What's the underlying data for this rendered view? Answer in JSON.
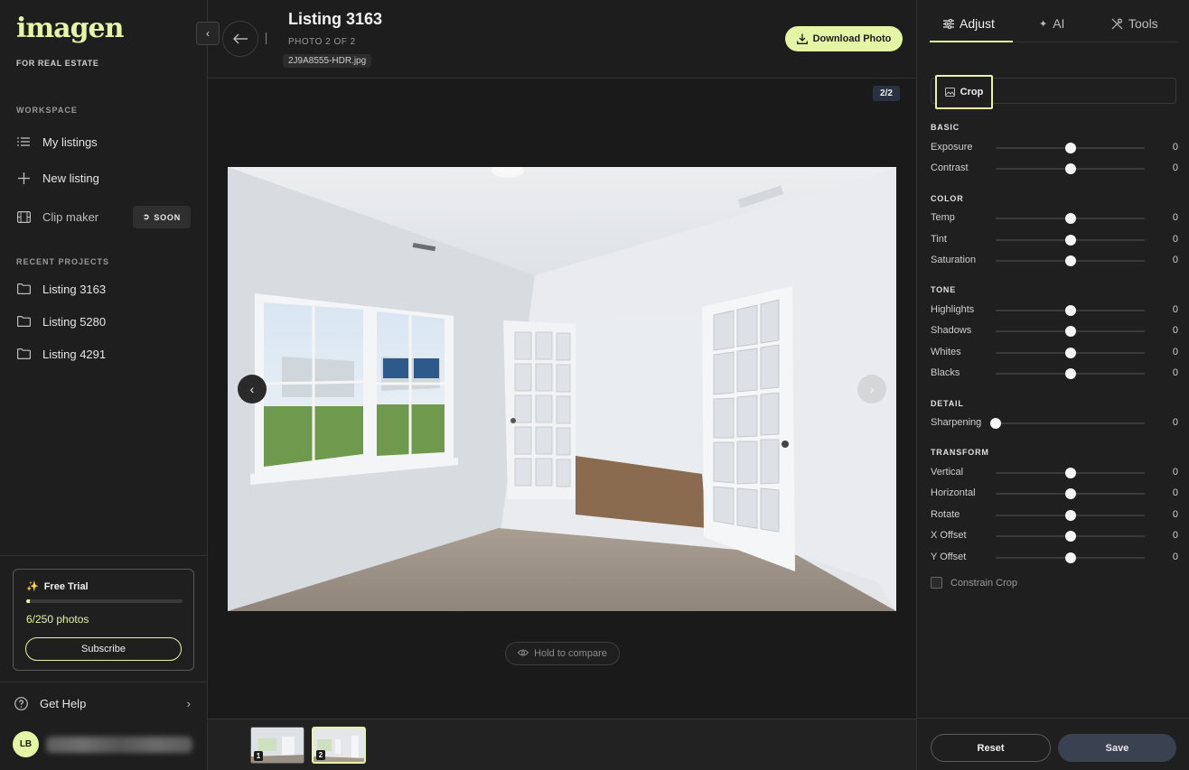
{
  "brand": {
    "logo": "imagen",
    "subtitle": "FOR REAL ESTATE",
    "accent": "#e4f5a6"
  },
  "sidebar": {
    "workspace_label": "WORKSPACE",
    "items": [
      {
        "label": "My listings",
        "icon": "list-icon"
      },
      {
        "label": "New listing",
        "icon": "plus-icon"
      },
      {
        "label": "Clip maker",
        "icon": "film-icon",
        "badge": "SOON"
      }
    ],
    "recent_label": "RECENT PROJECTS",
    "recent": [
      {
        "label": "Listing 3163",
        "icon": "folder-icon"
      },
      {
        "label": "Listing 5280",
        "icon": "folder-icon"
      },
      {
        "label": "Listing 4291",
        "icon": "folder-icon"
      }
    ],
    "trial": {
      "title": "Free Trial",
      "count": "6/250 photos",
      "progress": 0.024,
      "cta": "Subscribe"
    },
    "help": "Get Help",
    "user": {
      "initials": "LB"
    }
  },
  "header": {
    "title": "Listing 3163",
    "photo_meta": "PHOTO 2 OF 2",
    "filename": "2J9A8555-HDR.jpg",
    "download": "Download Photo"
  },
  "viewer": {
    "counter": "2/2",
    "compare": "Hold to compare",
    "thumbs": [
      {
        "num": "1"
      },
      {
        "num": "2",
        "active": true
      }
    ]
  },
  "panel": {
    "tabs": [
      {
        "label": "Adjust",
        "icon": "sliders-icon",
        "active": true
      },
      {
        "label": "AI",
        "icon": "sparkle-icon"
      },
      {
        "label": "Tools",
        "icon": "tools-icon"
      }
    ],
    "crop": "Crop",
    "groups": [
      {
        "label": "BASIC",
        "sliders": [
          {
            "label": "Exposure",
            "value": "0",
            "level": 0.5
          },
          {
            "label": "Contrast",
            "value": "0",
            "level": 0.5
          }
        ]
      },
      {
        "label": "COLOR",
        "sliders": [
          {
            "label": "Temp",
            "value": "0",
            "level": 0.5
          },
          {
            "label": "Tint",
            "value": "0",
            "level": 0.5
          },
          {
            "label": "Saturation",
            "value": "0",
            "level": 0.5
          }
        ]
      },
      {
        "label": "TONE",
        "sliders": [
          {
            "label": "Highlights",
            "value": "0",
            "level": 0.5
          },
          {
            "label": "Shadows",
            "value": "0",
            "level": 0.5
          },
          {
            "label": "Whites",
            "value": "0",
            "level": 0.5
          },
          {
            "label": "Blacks",
            "value": "0",
            "level": 0.5
          }
        ]
      },
      {
        "label": "DETAIL",
        "sliders": [
          {
            "label": "Sharpening",
            "value": "0",
            "level": 0.0
          }
        ]
      },
      {
        "label": "TRANSFORM",
        "sliders": [
          {
            "label": "Vertical",
            "value": "0",
            "level": 0.5
          },
          {
            "label": "Horizontal",
            "value": "0",
            "level": 0.5
          },
          {
            "label": "Rotate",
            "value": "0",
            "level": 0.5
          },
          {
            "label": "X Offset",
            "value": "0",
            "level": 0.5
          },
          {
            "label": "Y Offset",
            "value": "0",
            "level": 0.5
          }
        ]
      }
    ],
    "constrain": "Constrain Crop",
    "reset": "Reset",
    "save": "Save"
  }
}
